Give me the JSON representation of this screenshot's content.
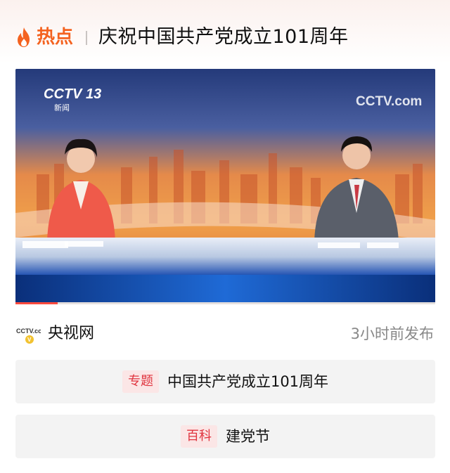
{
  "header": {
    "hot_label": "热点",
    "title": "庆祝中国共产党成立101周年"
  },
  "video": {
    "channel_logo": "CCTV 13",
    "channel_sub": "新闻",
    "watermark": "CCTV.com",
    "progress": 0.1
  },
  "source": {
    "logo_text": "CCTV.com",
    "name": "央视网",
    "published": "3小时前发布"
  },
  "cards": [
    {
      "tag": "专题",
      "text": "中国共产党成立101周年"
    },
    {
      "tag": "百科",
      "text": "建党节"
    }
  ],
  "colors": {
    "accent": "#f4621f",
    "tag_red": "#e0343f",
    "progress": "#ff4a3d"
  }
}
